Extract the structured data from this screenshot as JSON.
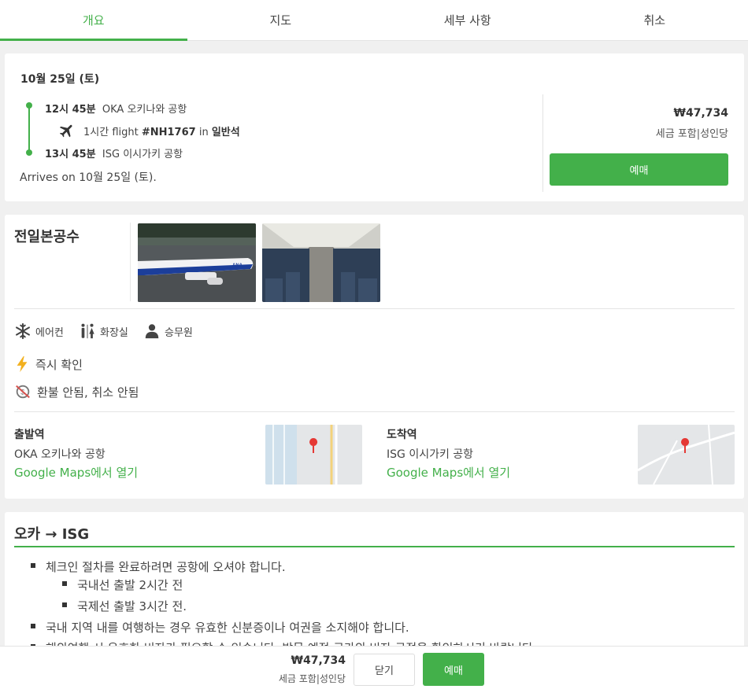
{
  "tabs": [
    {
      "label": "개요",
      "active": true
    },
    {
      "label": "지도",
      "active": false
    },
    {
      "label": "세부 사항",
      "active": false
    },
    {
      "label": "취소",
      "active": false
    }
  ],
  "trip": {
    "date": "10월 25일 (토)",
    "depart_time": "12시 45분",
    "depart_place": "OKA 오키나와 공항",
    "duration": "1시간 flight",
    "flight_no": "#NH1767",
    "in_word": "in",
    "cabin": "일반석",
    "arrive_time": "13시 45분",
    "arrive_place": "ISG 이시가키 공항",
    "arrives_note": "Arrives on 10월 25일 (토)."
  },
  "pricing": {
    "price": "₩47,734",
    "sub": "세금 포함|성인당",
    "book_label": "예매"
  },
  "operator": {
    "name": "전일본공수",
    "amenities": [
      {
        "icon": "snowflake-icon",
        "label": "에어컨"
      },
      {
        "icon": "restroom-icon",
        "label": "화장실"
      },
      {
        "icon": "attendant-icon",
        "label": "승무원"
      }
    ],
    "instant": "즉시 확인",
    "refund": "환불 안됨, 취소 안됨"
  },
  "stations": {
    "departure": {
      "title": "출발역",
      "name": "OKA 오키나와 공항",
      "link": "Google Maps에서 열기"
    },
    "arrival": {
      "title": "도착역",
      "name": "ISG 이시가키 공항",
      "link": "Google Maps에서 열기"
    }
  },
  "info": {
    "title": "오카 → ISG",
    "bullets": [
      "체크인 절차를 완료하려면 공항에 오셔야 합니다.",
      "국내선 출발 2시간 전",
      "국제선 출발 3시간 전.",
      "국내 지역 내를 여행하는 경우 유효한 신분증이나 여권을 소지해야 합니다.",
      "해외여행 시 유효한 비자가 필요할 수 있습니다. 방문 예정 국가의 비자 규정을 확인하시기 바랍니다."
    ]
  },
  "bottom_bar": {
    "price": "₩47,734",
    "sub": "세금 포함|성인당",
    "close_label": "닫기",
    "book_label": "예매"
  },
  "colors": {
    "accent": "#43b04a",
    "background": "#f0f0f0"
  }
}
